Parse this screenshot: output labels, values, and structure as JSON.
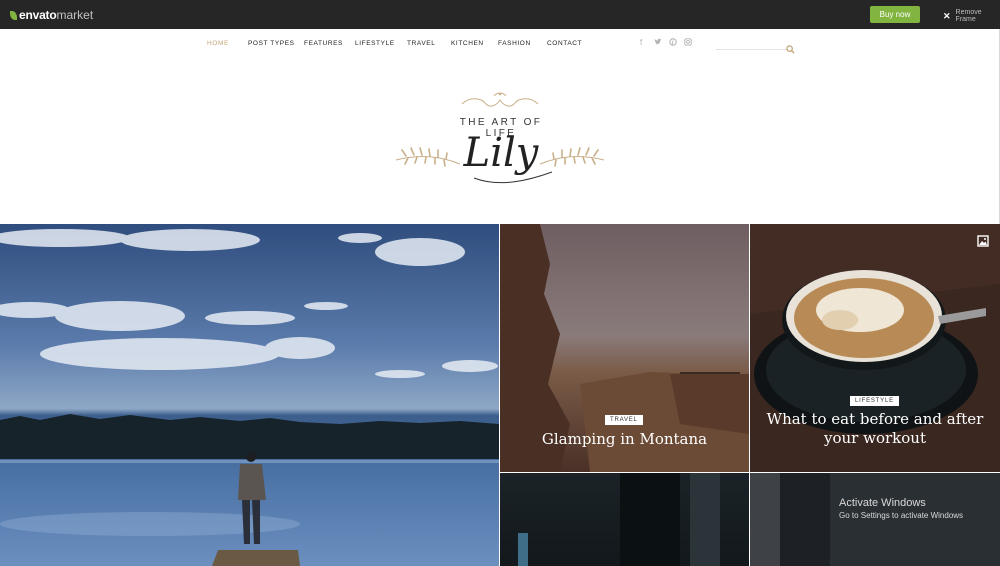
{
  "envato": {
    "brand": "envato",
    "market": "market",
    "buy_now": "Buy now",
    "remove_frame": "Remove Frame",
    "colors": {
      "bar": "#262626",
      "accent": "#82b440"
    }
  },
  "nav": {
    "items": [
      "HOME",
      "POST TYPES",
      "FEATURES",
      "LIFESTYLE",
      "TRAVEL",
      "KITCHEN",
      "FASHION",
      "CONTACT"
    ],
    "active": "HOME",
    "social_icons": [
      "facebook-icon",
      "twitter-icon",
      "pinterest-icon",
      "instagram-icon"
    ],
    "search_icon": "search-icon",
    "active_color": "#c2a579"
  },
  "logo": {
    "tagline": "THE ART OF LIFE",
    "word": "Lily"
  },
  "posts": {
    "montana": {
      "category": "TRAVEL",
      "title": "Glamping in Montana"
    },
    "coffee": {
      "category": "LIFESTYLE",
      "title": "What to eat before and after your workout",
      "format_icon": "image-icon"
    }
  },
  "watermark": {
    "title": "Activate Windows",
    "subtitle": "Go to Settings to activate Windows"
  }
}
